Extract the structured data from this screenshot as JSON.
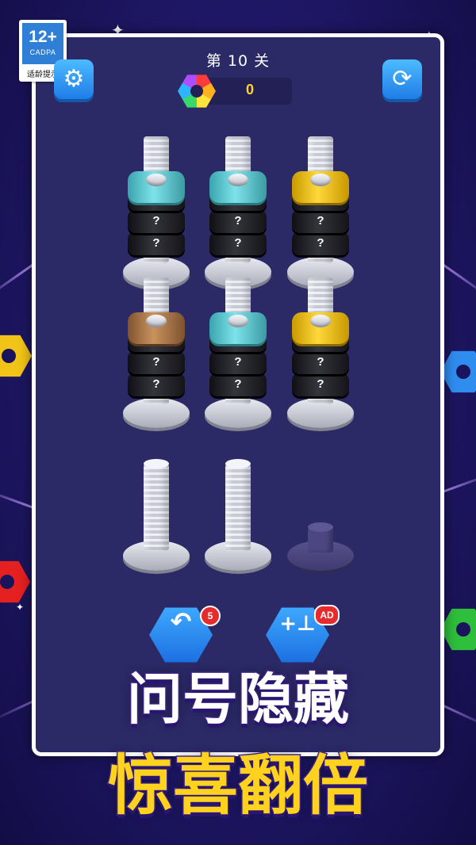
{
  "badge": {
    "age": "12+",
    "org": "CADPA",
    "tip": "适龄提示"
  },
  "header": {
    "level_text": "第 10 关",
    "score": "0",
    "settings_icon": "gear-icon",
    "restart_icon": "refresh-icon"
  },
  "board": {
    "row1": [
      {
        "cap_color": "#5fcfd6",
        "hidden": [
          "?",
          "?",
          "?"
        ]
      },
      {
        "cap_color": "#5fcfd6",
        "hidden": [
          "?",
          "?",
          "?"
        ]
      },
      {
        "cap_color": "#f2c418",
        "hidden": [
          "?",
          "?",
          "?"
        ]
      }
    ],
    "row2": [
      {
        "cap_color": "#b07b4e",
        "hidden": [
          "?",
          "?",
          "?"
        ]
      },
      {
        "cap_color": "#5fcfd6",
        "hidden": [
          "?",
          "?",
          "?"
        ]
      },
      {
        "cap_color": "#f2c418",
        "hidden": [
          "?",
          "?",
          "?"
        ]
      }
    ]
  },
  "actions": {
    "undo": {
      "icon": "undo-icon",
      "badge": "5"
    },
    "add_peg": {
      "icon": "add-peg-icon",
      "badge": "AD"
    }
  },
  "slogan": {
    "line1": "问号隐藏",
    "line2": "惊喜翻倍"
  }
}
